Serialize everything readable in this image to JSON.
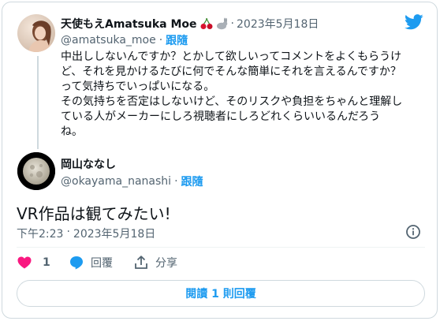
{
  "quoted_tweet": {
    "display_name": "天使もえAmatsuka Moe",
    "name_emojis": "🍒🐇",
    "date": "2023年5月18日",
    "handle": "@amatsuka_moe",
    "follow_label": "跟隨",
    "lines": [
      "中出ししないんですか？とかして欲しいってコメントをよくもらうけ",
      "ど、それを見かけるたびに何でそんな簡単にそれを言えるんですか？",
      "って気持ちでいっぱいになる。",
      "その気持ちを否定はしないけど、そのリスクや負担をちゃんと理解し",
      "ている人がメーカーにしろ視聴者にしろどれくらいいるんだろう",
      "ね。"
    ]
  },
  "reply_tweet": {
    "display_name": "岡山ななし",
    "handle": "@okayama_nanashi",
    "follow_label": "跟隨",
    "text": "VR作品は観てみたい!",
    "time": "下午2:23",
    "date": "2023年5月18日",
    "like_count": "1",
    "reply_label": "回覆",
    "share_label": "分享",
    "read_replies_label": "閱讀 1 則回覆"
  },
  "colors": {
    "accent": "#1d9bf0",
    "like": "#f91880",
    "muted": "#536471",
    "border": "#cfd9de"
  },
  "icons": {
    "brand": "twitter-bird-icon",
    "info": "info-icon",
    "like": "heart-icon",
    "reply": "speech-bubble-icon",
    "share": "share-upload-icon"
  }
}
